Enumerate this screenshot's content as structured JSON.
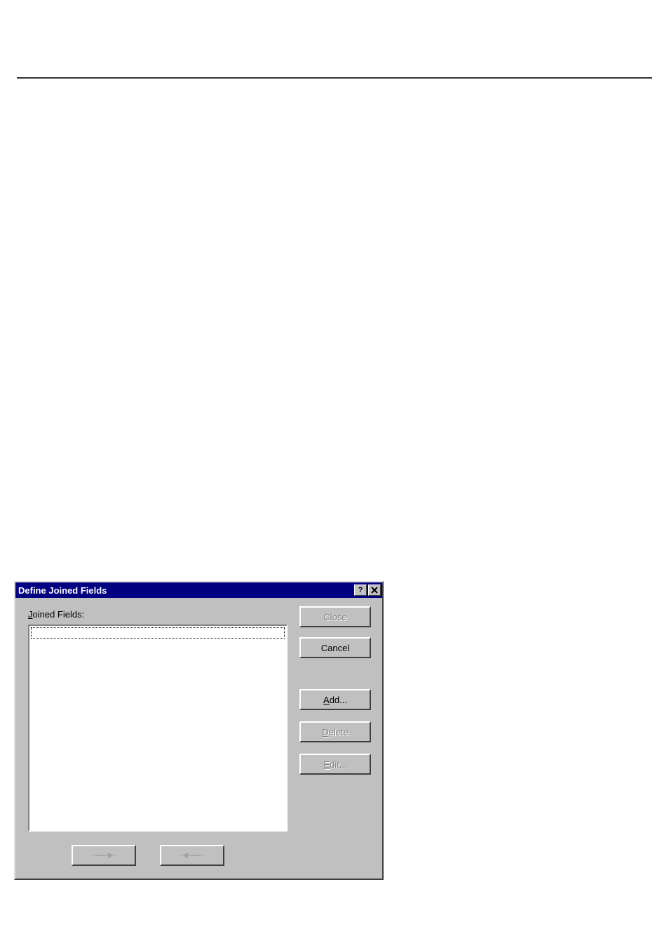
{
  "dialog": {
    "title": "Define Joined Fields",
    "label_prefix": "J",
    "label_rest": "oined Fields:",
    "buttons": {
      "close": "Close",
      "cancel": "Cancel",
      "add_prefix": "A",
      "add_rest": "dd...",
      "delete_prefix": "D",
      "delete_rest": "elete",
      "edit_prefix": "E",
      "edit_rest": "dit..."
    },
    "joined_fields": []
  }
}
